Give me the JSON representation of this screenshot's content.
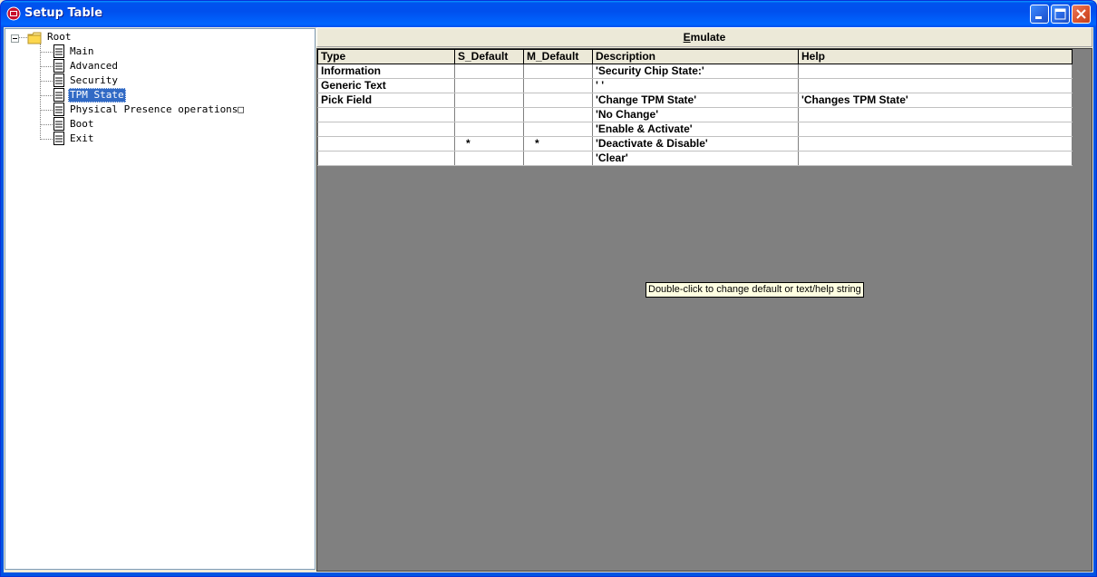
{
  "window": {
    "title": "Setup Table"
  },
  "tree": {
    "root_label": "Root",
    "items": [
      {
        "label": "Main",
        "selected": false
      },
      {
        "label": "Advanced",
        "selected": false
      },
      {
        "label": "Security",
        "selected": false
      },
      {
        "label": "TPM State",
        "selected": true
      },
      {
        "label": "Physical Presence operations□",
        "selected": false
      },
      {
        "label": "Boot",
        "selected": false
      },
      {
        "label": "Exit",
        "selected": false
      }
    ]
  },
  "toolbar": {
    "emulate_label": "Emulate",
    "emulate_accelerator": "E"
  },
  "grid": {
    "columns": [
      "Type",
      "S_Default",
      "M_Default",
      "Description",
      "Help"
    ],
    "rows": [
      [
        "Information",
        "",
        "",
        "'Security Chip State:'",
        ""
      ],
      [
        "Generic Text",
        "",
        "",
        "' '",
        ""
      ],
      [
        "Pick Field",
        "",
        "",
        "'Change TPM State'",
        "'Changes TPM State'"
      ],
      [
        "",
        "",
        "",
        "'No Change'",
        ""
      ],
      [
        "",
        "",
        "",
        "'Enable & Activate'",
        ""
      ],
      [
        "",
        "*",
        "*",
        "'Deactivate & Disable'",
        ""
      ],
      [
        "",
        "",
        "",
        "'Clear'",
        ""
      ]
    ]
  },
  "tooltip": {
    "text": "Double-click to change default or text/help string"
  },
  "colors": {
    "titlebar": "#0054e3",
    "selection": "#316ac5",
    "grid_background": "#808080",
    "tooltip_background": "#ffffe1"
  }
}
